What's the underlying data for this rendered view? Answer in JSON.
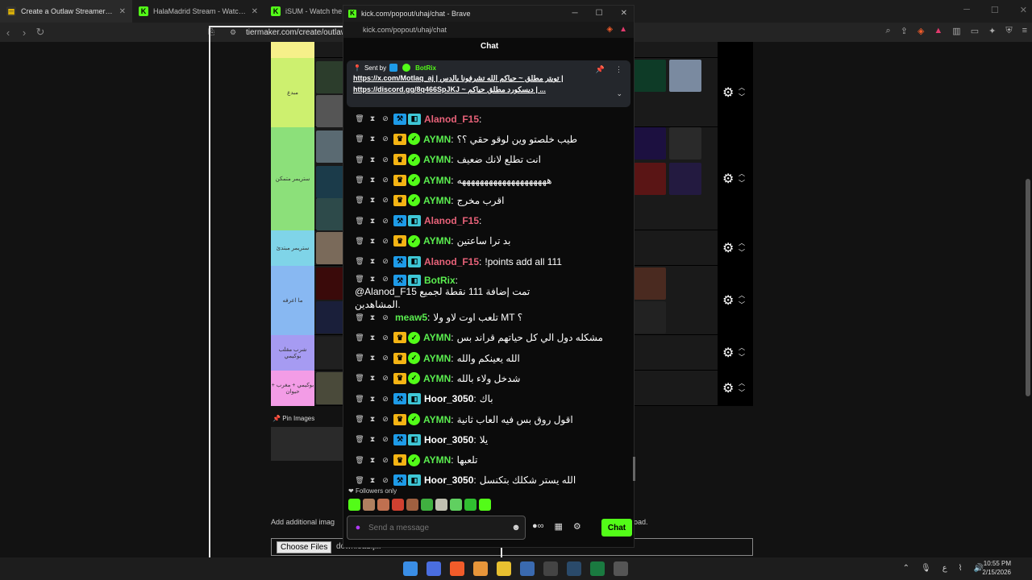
{
  "browser_tabs": [
    {
      "title": "Create a Outlaw Streamers Tier List",
      "icon": "tiermaker-icon"
    },
    {
      "title": "HalaMadrid Stream - Watch Live on Kick",
      "icon": "kick-icon"
    },
    {
      "title": "iSUM - Watch the World's best streamers",
      "icon": "kick-icon"
    }
  ],
  "address_bar": "tiermaker.com/create/outlaw",
  "tiers": [
    {
      "label": "",
      "color": "#f6f08a"
    },
    {
      "label": "مبدع",
      "color": "#cdf06f"
    },
    {
      "label": "ستريمر متمكن",
      "color": "#8ce07a"
    },
    {
      "label": "ستريمر مبتدئ",
      "color": "#7fd4e8"
    },
    {
      "label": "ما اعرفه",
      "color": "#88b8f2"
    },
    {
      "label": "شرب مقلب بوكيمي",
      "color": "#a69bf2"
    },
    {
      "label": "بوكيمي + مغرب + حيوان",
      "color": "#f39ce6"
    }
  ],
  "page_texts": {
    "pin_images": "Pin Images",
    "add_additional": "Add additional imag",
    "add_additional_tail": "oad.",
    "choose_files": "Choose Files",
    "upload_name": "download.jfif"
  },
  "popout": {
    "window_title": "kick.com/popout/uhaj/chat - Brave",
    "url": "kick.com/popout/uhaj/chat",
    "chat_header": "Chat",
    "pinned": {
      "sent_by": "Sent by",
      "author": "BotRix",
      "line1": "https://x.com/Motlaq_aj | تويتر مطلق ~ حياكم الله تشرفونا بالدس |",
      "line2": "https://discord.gg/8q466SpJKJ ~ ديسكورد مطلق حياكم | ..."
    },
    "messages": [
      {
        "user": "Alanod_F15",
        "color": "pink",
        "badges": [
          "blue",
          "sub"
        ],
        "text": ""
      },
      {
        "user": "AYMN",
        "color": "green",
        "badges": [
          "crown",
          "ver"
        ],
        "text": "طيب خلصتو وين لوقو حقي ؟؟"
      },
      {
        "user": "AYMN",
        "color": "green",
        "badges": [
          "crown",
          "ver"
        ],
        "text": "انت تطلع لانك ضعيف"
      },
      {
        "user": "AYMN",
        "color": "green",
        "badges": [
          "crown",
          "ver"
        ],
        "text": "ههههههههههههههههههههه"
      },
      {
        "user": "AYMN",
        "color": "green",
        "badges": [
          "crown",
          "ver"
        ],
        "text": "اقرب مخرج"
      },
      {
        "user": "Alanod_F15",
        "color": "pink",
        "badges": [
          "blue",
          "sub"
        ],
        "text": ""
      },
      {
        "user": "AYMN",
        "color": "green",
        "badges": [
          "crown",
          "ver"
        ],
        "text": "بد ترا ساعتين"
      },
      {
        "user": "Alanod_F15",
        "color": "pink",
        "badges": [
          "blue",
          "sub"
        ],
        "text": "!points add all 111"
      },
      {
        "user": "BotRix",
        "color": "green",
        "badges": [
          "blue",
          "sub"
        ],
        "text": "@Alanod_F15 تمت إضافة 111 نقطة لجميع",
        "wrap": "المشاهدين."
      },
      {
        "user": "meaw5",
        "color": "green",
        "badges": [],
        "text": "تلعب اوت لاو ولا MT ؟"
      },
      {
        "user": "AYMN",
        "color": "green",
        "badges": [
          "crown",
          "ver"
        ],
        "text": "مشكله دول الي كل حياتهم قراند بس"
      },
      {
        "user": "AYMN",
        "color": "green",
        "badges": [
          "crown",
          "ver"
        ],
        "text": "الله يعينكم والله"
      },
      {
        "user": "AYMN",
        "color": "green",
        "badges": [
          "crown",
          "ver"
        ],
        "text": "شدخل ولاء بالله"
      },
      {
        "user": "Hoor_3050",
        "color": "white",
        "badges": [
          "blue",
          "sub"
        ],
        "text": "باك"
      },
      {
        "user": "AYMN",
        "color": "green",
        "badges": [
          "crown",
          "ver"
        ],
        "text": "اقول روق بس فيه العاب ثانية"
      },
      {
        "user": "Hoor_3050",
        "color": "white",
        "badges": [
          "blue",
          "sub"
        ],
        "text": "يلا"
      },
      {
        "user": "AYMN",
        "color": "green",
        "badges": [
          "crown",
          "ver"
        ],
        "text": "تلعبها"
      },
      {
        "user": "Hoor_3050",
        "color": "white",
        "badges": [
          "blue",
          "sub"
        ],
        "text": "الله يستر شكلك بتكنسل"
      }
    ],
    "followers_only": "Followers only",
    "input_placeholder": "Send a message",
    "chat_button": "Chat"
  },
  "taskbar": {
    "time": "10:55 PM",
    "date": "2/15/2026"
  },
  "colors": {
    "kick_green": "#53fc18",
    "name_green": "#5aed4f",
    "name_pink": "#e86279"
  }
}
